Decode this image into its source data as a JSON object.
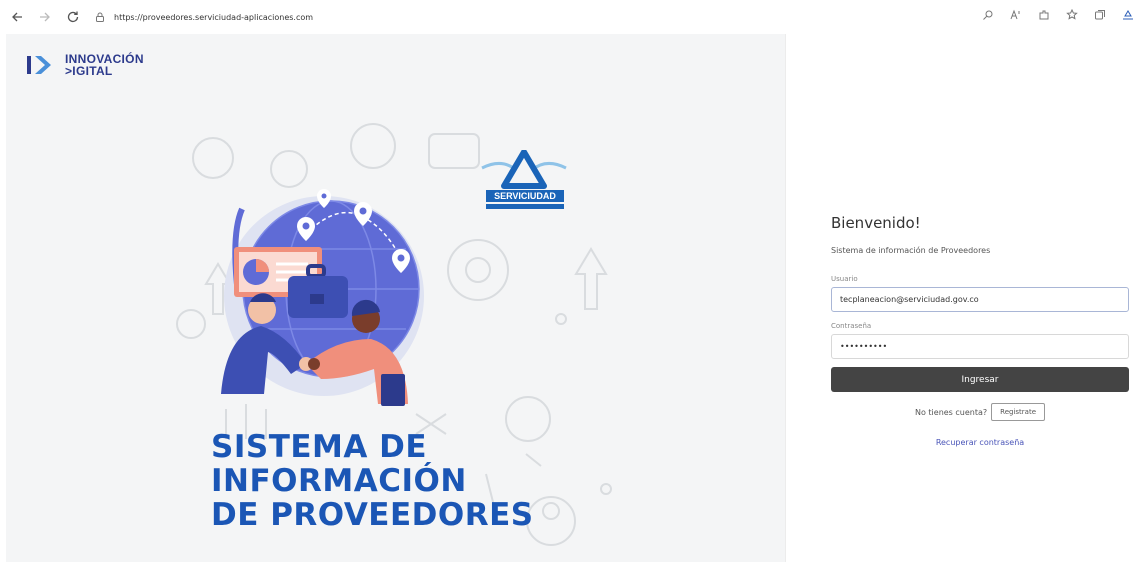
{
  "browser": {
    "url": "https://proveedores.serviciudad-aplicaciones.com"
  },
  "brand": {
    "line1": "INNOVACIÓN",
    "line2": ">IGITAL"
  },
  "logo": {
    "name": "SERVICIUDAD"
  },
  "hero": {
    "line1": "SISTEMA DE",
    "line2": "INFORMACIÓN",
    "line3": "DE PROVEEDORES"
  },
  "login": {
    "welcome": "Bienvenido!",
    "subtitle": "Sistema de información de Proveedores",
    "user_label": "Usuario",
    "user_value": "tecplaneacion@serviciudad.gov.co",
    "password_label": "Contraseña",
    "password_value": "••••••••••",
    "submit_label": "Ingresar",
    "no_account_text": "No tienes cuenta?",
    "register_label": "Registrate",
    "recover_label": "Recuperar contraseña"
  },
  "colors": {
    "brand_blue": "#1b56b5",
    "navy": "#2c3a8c",
    "button_dark": "#444444",
    "link": "#4a55b8"
  }
}
